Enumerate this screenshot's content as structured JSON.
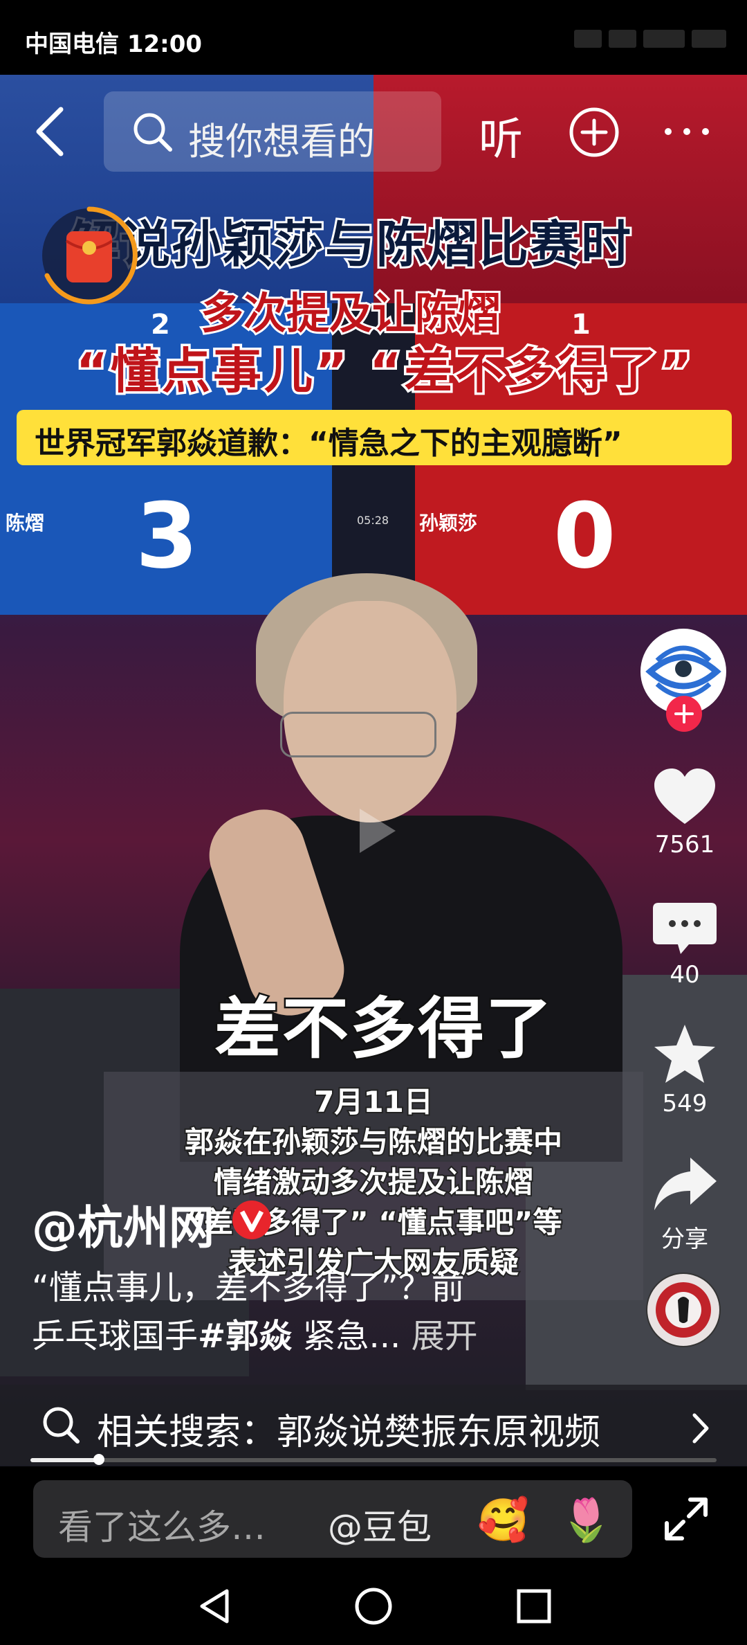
{
  "status_bar": {
    "carrier_time": "中国电信 12:00"
  },
  "top_bar": {
    "search_placeholder": "搜你想看的",
    "listen_label": "听"
  },
  "video": {
    "headline_line1": "解说孙颖莎与陈熠比赛时",
    "headline_line2": "多次提及让陈熠",
    "headline_line3": "“懂点事儿” “差不多得了”",
    "yellow_banner": "世界冠军郭焱道歉：“情急之下的主观臆断”",
    "score_left": "2",
    "score_right": "1",
    "game_left": "3",
    "game_right": "0",
    "player_left": "陈熠",
    "player_right": "孙颖莎",
    "clock": "05:28",
    "subtitle": "差不多得了",
    "caption_lines": [
      "7月11日",
      "郭焱在孙颖莎与陈熠的比赛中",
      "情绪激动多次提及让陈熠",
      "“差不多得了” “懂点事吧”等",
      "表述引发广大网友质疑"
    ]
  },
  "right_rail": {
    "likes": "7561",
    "comments": "40",
    "favorites": "549",
    "share_label": "分享"
  },
  "post": {
    "author": "@杭州网",
    "desc_line1": "“懂点事儿，差不多得了”？前",
    "desc_line2_prefix": "乒乓球国手",
    "desc_hashtag": "#郭焱",
    "desc_line2_suffix": " 紧急...",
    "expand_label": "展开"
  },
  "related_search": {
    "text": "相关搜索：郭焱说樊振东原视频"
  },
  "progress": {
    "played_fraction": 0.1
  },
  "bottom_bar": {
    "comment_placeholder": "看了这么多…",
    "doubao_label": "@豆包",
    "emoji_1": "🥰",
    "emoji_2": "🌷"
  },
  "colors": {
    "accent_red": "#f2274a",
    "banner_yellow": "#ffe03a"
  }
}
